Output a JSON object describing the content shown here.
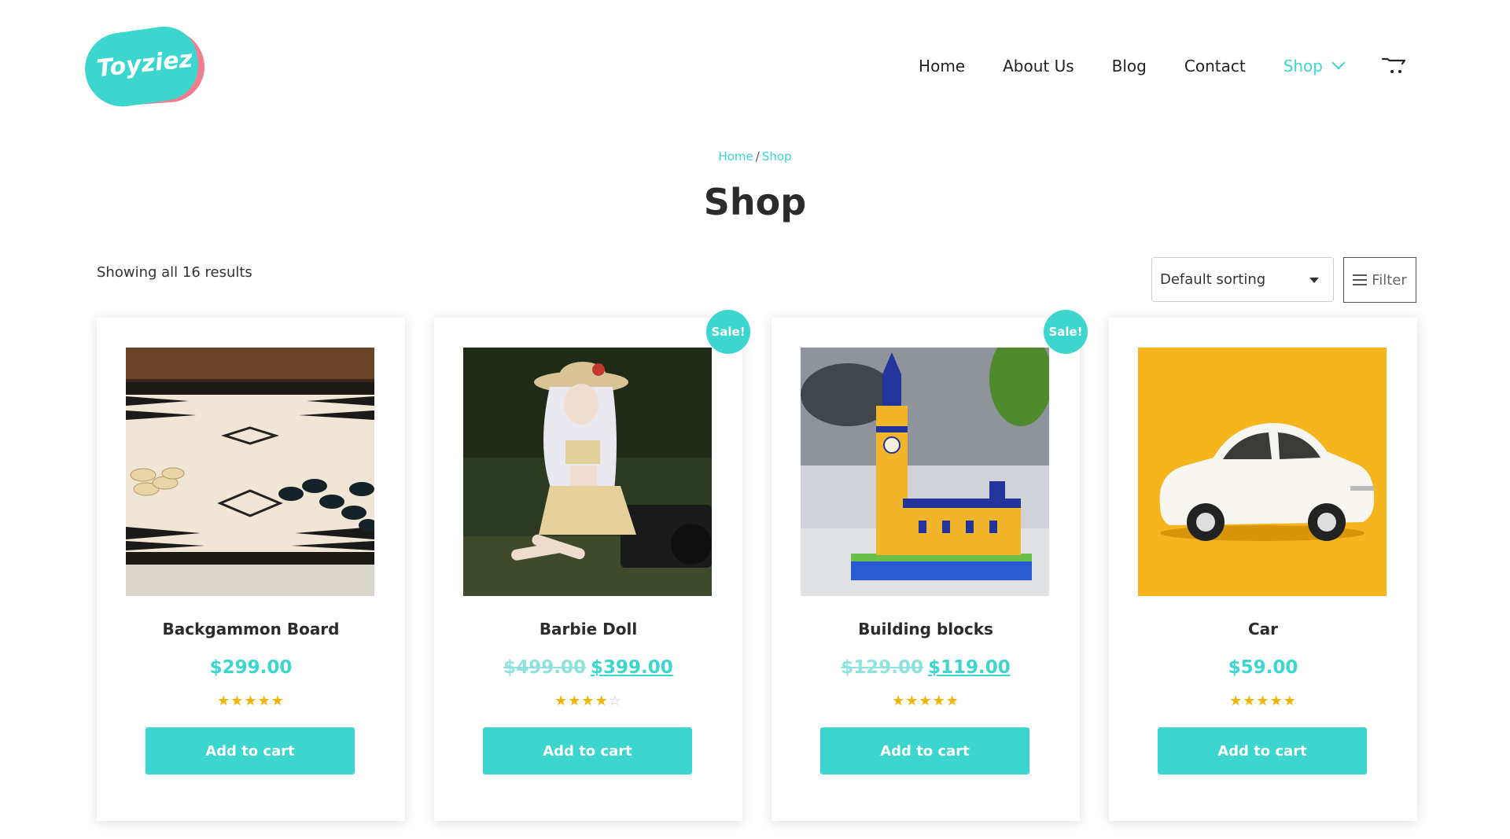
{
  "brand": {
    "logo_text": "Toyziez",
    "accent": "#3cd6cf",
    "logo_pink": "#f47c8f",
    "star_color": "#f5b301"
  },
  "nav": {
    "items": [
      {
        "label": "Home"
      },
      {
        "label": "About Us"
      },
      {
        "label": "Blog"
      },
      {
        "label": "Contact"
      },
      {
        "label": "Shop"
      }
    ],
    "cart_icon": "cart-icon",
    "dropdown_icon": "chevron-down-icon"
  },
  "breadcrumb": {
    "home": "Home",
    "separator": "/",
    "current": "Shop"
  },
  "page_title": "Shop",
  "toolbar": {
    "result_count": "Showing all 16 results",
    "sort_selected": "Default sorting",
    "filter_label": "Filter",
    "filter_icon": "menu-icon"
  },
  "products": [
    {
      "name": "Backgammon Board",
      "price": "$299.00",
      "old_price": "",
      "sale_price": "",
      "rating": 5,
      "sale_badge": "",
      "button": "Add to cart",
      "image": "backgammon-board-image"
    },
    {
      "name": "Barbie Doll",
      "price": "",
      "old_price": "$499.00",
      "sale_price": "$399.00",
      "rating": 4,
      "sale_badge": "Sale!",
      "button": "Add to cart",
      "image": "doll-image"
    },
    {
      "name": "Building blocks",
      "price": "",
      "old_price": "$129.00",
      "sale_price": "$119.00",
      "rating": 5,
      "sale_badge": "Sale!",
      "button": "Add to cart",
      "image": "building-blocks-image"
    },
    {
      "name": "Car",
      "price": "$59.00",
      "old_price": "",
      "sale_price": "",
      "rating": 5,
      "sale_badge": "",
      "button": "Add to cart",
      "image": "toy-car-image"
    }
  ]
}
